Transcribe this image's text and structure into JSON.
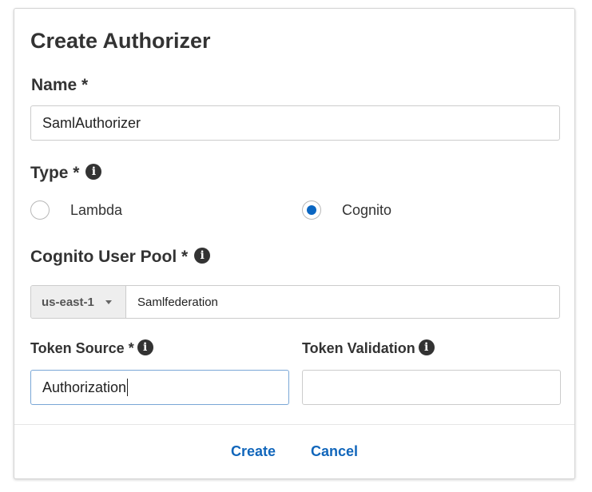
{
  "dialog": {
    "title": "Create Authorizer"
  },
  "name_field": {
    "label": "Name *",
    "value": "SamlAuthorizer"
  },
  "type_field": {
    "label": "Type *",
    "options": [
      {
        "label": "Lambda",
        "selected": false
      },
      {
        "label": "Cognito",
        "selected": true
      }
    ]
  },
  "user_pool": {
    "label": "Cognito User Pool *",
    "region": "us-east-1",
    "value": "Samlfederation"
  },
  "token_source": {
    "label": "Token Source *",
    "value": "Authorization"
  },
  "token_validation": {
    "label": "Token Validation",
    "value": ""
  },
  "footer": {
    "create_label": "Create",
    "cancel_label": "Cancel"
  },
  "colors": {
    "accent": "#0a66c2",
    "link": "#1166bb",
    "text": "#333333"
  },
  "icons": {
    "info": "info-icon",
    "dropdown": "caret-down-icon"
  }
}
